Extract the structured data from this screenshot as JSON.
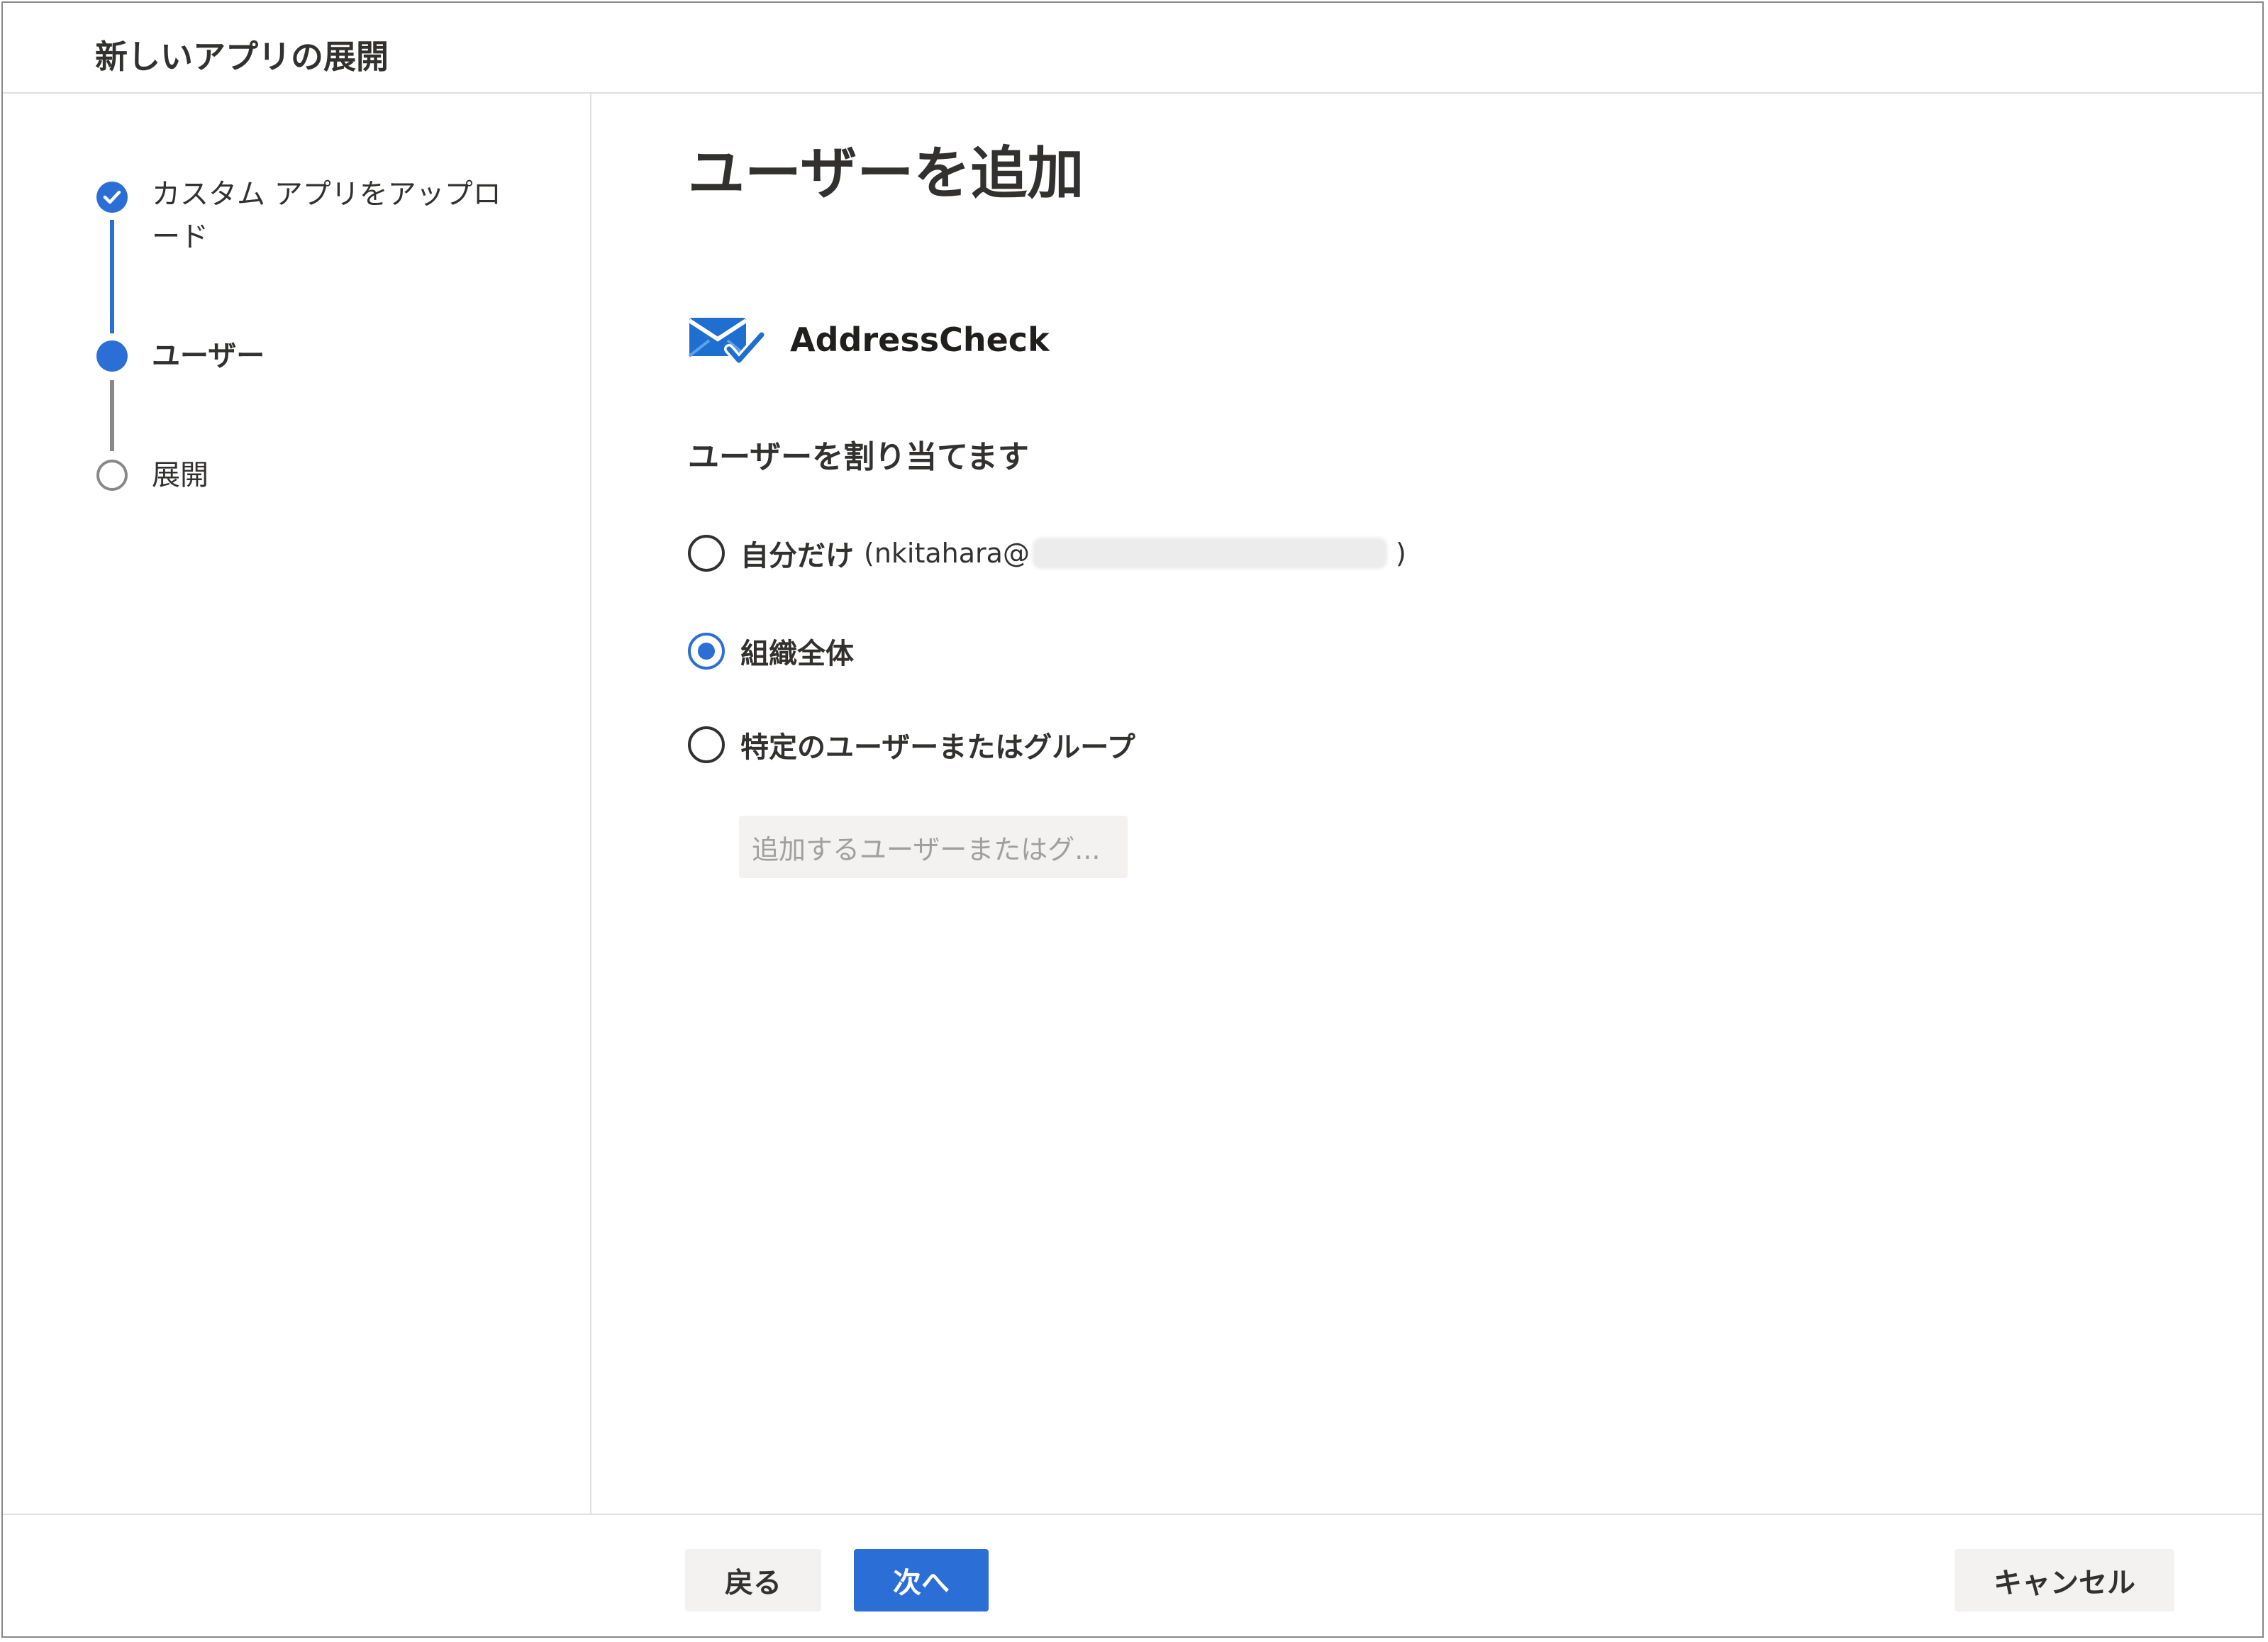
{
  "dialog": {
    "title": "新しいアプリの展開"
  },
  "steps": [
    {
      "line1": "カスタム アプリをアップロ",
      "line2": "ード",
      "status": "completed"
    },
    {
      "label": "ユーザー",
      "status": "current"
    },
    {
      "label": "展開",
      "status": "pending"
    }
  ],
  "main": {
    "page_title": "ユーザーを追加",
    "app": {
      "name": "AddressCheck",
      "icon": "envelope-check-icon"
    },
    "section_heading": "ユーザーを割り当てます",
    "options": [
      {
        "label": "自分だけ",
        "detail_prefix": "(nkitahara@",
        "detail_suffix": ")",
        "selected": false
      },
      {
        "label": "組織全体",
        "selected": true
      },
      {
        "label": "特定のユーザーまたはグループ",
        "selected": false
      }
    ],
    "picker": {
      "placeholder": "追加するユーザーまたはグ..."
    }
  },
  "footer": {
    "back_label": "戻る",
    "next_label": "次へ",
    "cancel_label": "キャンセル"
  },
  "colors": {
    "accent": "#2b6fd6",
    "border": "#e1dfdd",
    "text": "#323130",
    "muted": "#a19f9d"
  }
}
